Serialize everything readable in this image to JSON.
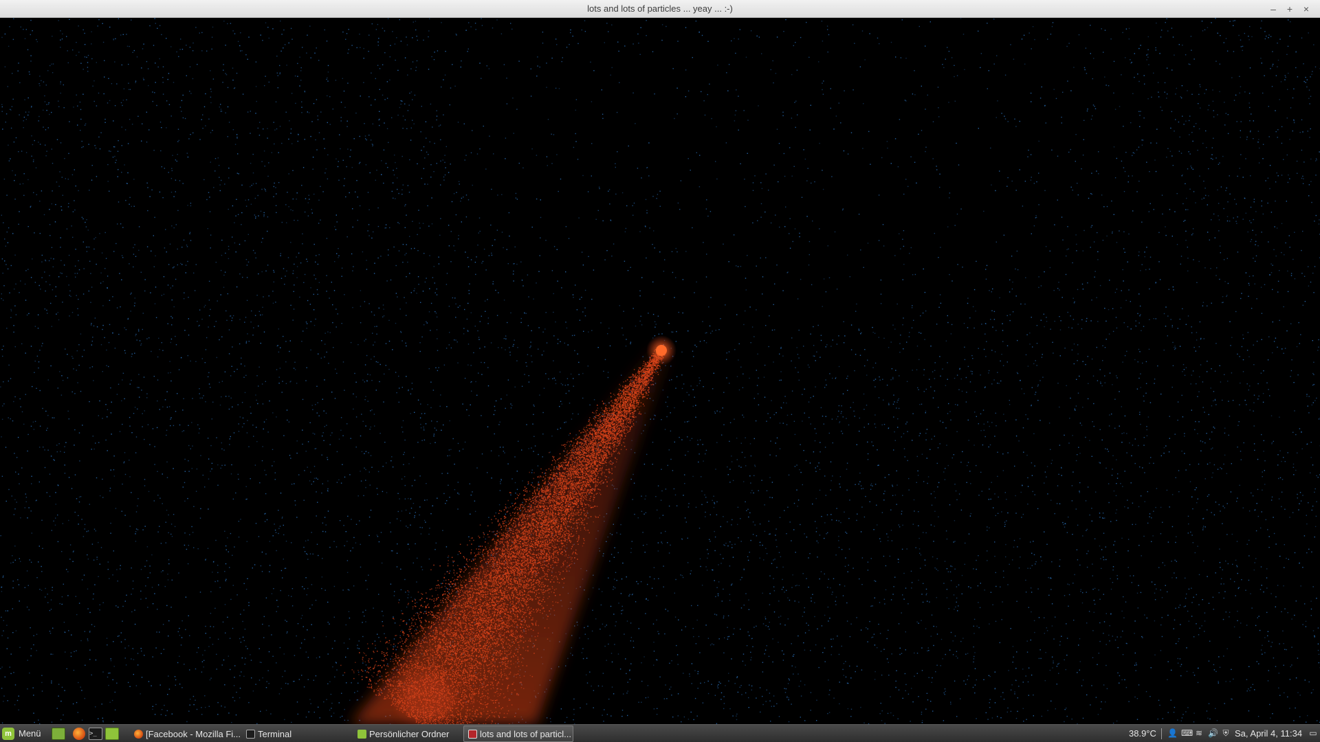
{
  "window": {
    "title": "lots and lots of particles ... yeay ... :-)",
    "minimize_glyph": "–",
    "maximize_glyph": "+",
    "close_glyph": "×"
  },
  "scene": {
    "background": "#000000",
    "star_color": "#2a6fb8",
    "trail_color": "#d8431a",
    "head_color": "#ff6a2a"
  },
  "taskbar": {
    "menu_label": "Menü",
    "launchers": [
      "desktop-icon",
      "firefox-icon",
      "terminal-icon",
      "folder-icon"
    ],
    "terminal_glyph": ">_",
    "tasks": [
      {
        "label": "[Facebook - Mozilla Fi...",
        "icon": "firefox-icon",
        "active": false
      },
      {
        "label": "Terminal",
        "icon": "terminal-icon",
        "active": false
      },
      {
        "label": "Persönlicher Ordner",
        "icon": "folder-icon",
        "active": false
      },
      {
        "label": "lots and lots of particl...",
        "icon": "app-icon",
        "active": true
      }
    ],
    "tray": {
      "temperature": "38.9°C",
      "user_glyph": "👤",
      "keyboard_glyph": "⌨",
      "wifi_glyph": "≋",
      "volume_glyph": "🔊",
      "shield_glyph": "⛨",
      "clock": "Sa, April  4, 11:34",
      "show_desktop_glyph": "▭"
    }
  }
}
